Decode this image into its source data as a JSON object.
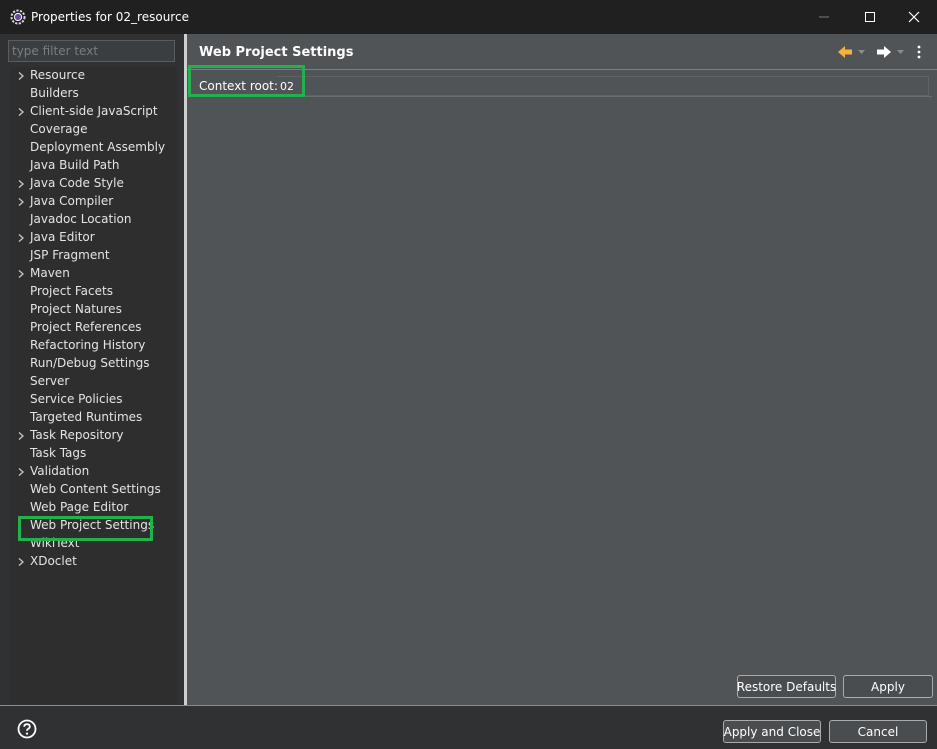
{
  "window": {
    "title": "Properties for 02_resource"
  },
  "filter": {
    "placeholder": "type filter text"
  },
  "tree": {
    "items": [
      {
        "label": "Resource",
        "expandable": true
      },
      {
        "label": "Builders",
        "expandable": false
      },
      {
        "label": "Client-side JavaScript",
        "expandable": true
      },
      {
        "label": "Coverage",
        "expandable": false
      },
      {
        "label": "Deployment Assembly",
        "expandable": false
      },
      {
        "label": "Java Build Path",
        "expandable": false
      },
      {
        "label": "Java Code Style",
        "expandable": true
      },
      {
        "label": "Java Compiler",
        "expandable": true
      },
      {
        "label": "Javadoc Location",
        "expandable": false
      },
      {
        "label": "Java Editor",
        "expandable": true
      },
      {
        "label": "JSP Fragment",
        "expandable": false
      },
      {
        "label": "Maven",
        "expandable": true
      },
      {
        "label": "Project Facets",
        "expandable": false
      },
      {
        "label": "Project Natures",
        "expandable": false
      },
      {
        "label": "Project References",
        "expandable": false
      },
      {
        "label": "Refactoring History",
        "expandable": false
      },
      {
        "label": "Run/Debug Settings",
        "expandable": false
      },
      {
        "label": "Server",
        "expandable": false
      },
      {
        "label": "Service Policies",
        "expandable": false
      },
      {
        "label": "Targeted Runtimes",
        "expandable": false
      },
      {
        "label": "Task Repository",
        "expandable": true
      },
      {
        "label": "Task Tags",
        "expandable": false
      },
      {
        "label": "Validation",
        "expandable": true
      },
      {
        "label": "Web Content Settings",
        "expandable": false
      },
      {
        "label": "Web Page Editor",
        "expandable": false
      },
      {
        "label": "Web Project Settings",
        "expandable": false
      },
      {
        "label": "WikiText",
        "expandable": false
      },
      {
        "label": "XDoclet",
        "expandable": true
      }
    ],
    "selected": "Web Project Settings"
  },
  "page": {
    "title": "Web Project Settings",
    "context_root_label": "Context root:",
    "context_root_value": "02"
  },
  "buttons": {
    "restore_defaults": "Restore Defaults",
    "apply": "Apply",
    "apply_and_close": "Apply and Close",
    "cancel": "Cancel"
  },
  "colors": {
    "highlight": "#22b14c",
    "nav_back_arrow": "#f2b33d",
    "background_panel": "#505456"
  },
  "icons": {
    "app": "eclipse-gear-icon",
    "help": "question-mark-icon",
    "back": "arrow-left-icon",
    "forward": "arrow-right-icon",
    "menu": "vertical-dots-icon"
  }
}
